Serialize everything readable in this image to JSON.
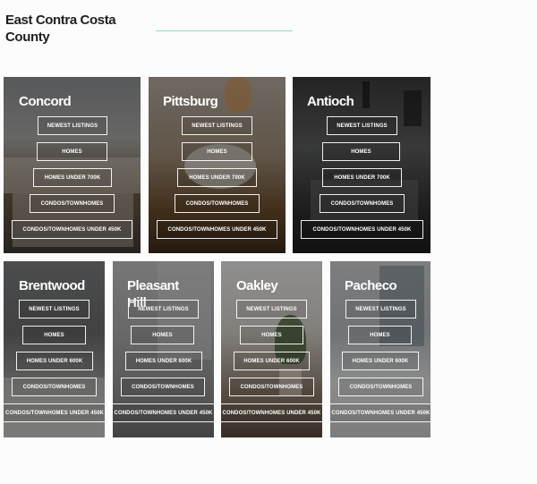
{
  "page": {
    "title": "East Contra Costa County"
  },
  "cards": [
    {
      "name": "Concord",
      "links": [
        "NEWEST LISTINGS",
        "HOMES",
        "HOMES UNDER 700K",
        "CONDOS/TOWNHOMES",
        "CONDOS/TOWNHOMES UNDER 450K"
      ]
    },
    {
      "name": "Pittsburg",
      "links": [
        "NEWEST LISTINGS",
        "HOMES",
        "HOMES UNDER 700K",
        "CONDOS/TOWNHOMES",
        "CONDOS/TOWNHOMES UNDER 450K"
      ]
    },
    {
      "name": "Antioch",
      "links": [
        "NEWEST LISTINGS",
        "HOMES",
        "HOMES UNDER 700K",
        "CONDOS/TOWNHOMES",
        "CONDOS/TOWNHOMES  UNDER 450K"
      ]
    },
    {
      "name": "Brentwood",
      "links": [
        "NEWEST LISTINGS",
        "HOMES",
        "HOMES UNDER 600K",
        "CONDOS/TOWNHOMES",
        "CONDOS/TOWNHOMES UNDER 450K"
      ]
    },
    {
      "name": "Pleasant Hill",
      "links": [
        "NEWEST LISTINGS",
        "HOMES",
        "HOMES UNDER 600K",
        "CONDOS/TOWNHOMES",
        "CONDOS/TOWNHOMES UNDER 450K"
      ]
    },
    {
      "name": "Oakley",
      "links": [
        "NEWEST LISTINGS",
        "HOMES",
        "HOMES UNDER 600K",
        "CONDOS/TOWNHOMES",
        "CONDOS/TOWNHOMES UNDER 450K"
      ]
    },
    {
      "name": "Pacheco",
      "links": [
        "NEWEST LISTINGS",
        "HOMES",
        "HOMES UNDER 600K",
        "CONDOS/TOWNHOMES",
        "CONDOS/TOWNHOMES UNDER 450K"
      ]
    }
  ]
}
